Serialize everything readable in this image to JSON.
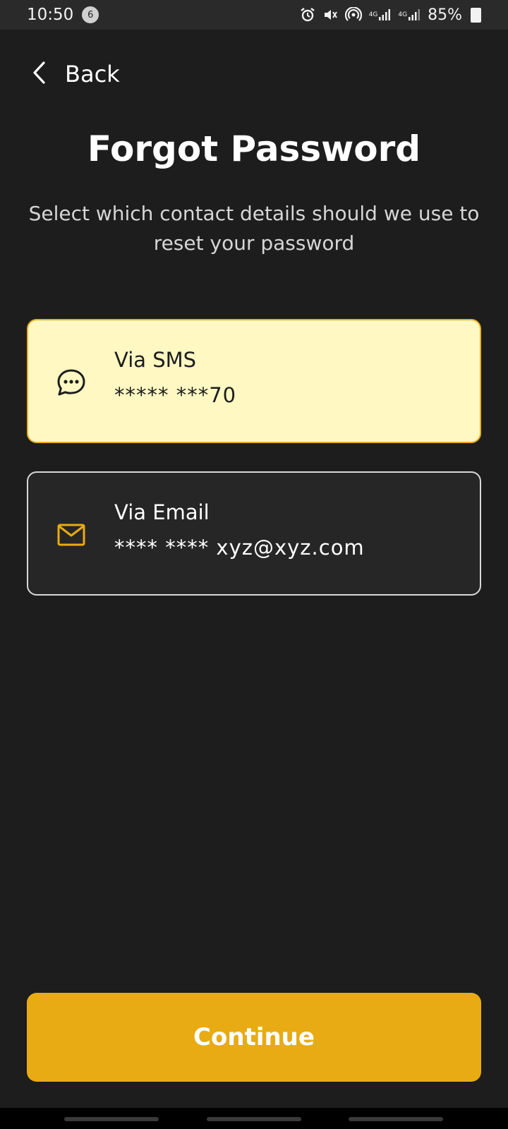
{
  "status_bar": {
    "time": "10:50",
    "notification_count": "6",
    "network_1": "4G",
    "network_2": "4G",
    "battery_percent": "85%"
  },
  "header": {
    "back_label": "Back",
    "title": "Forgot Password",
    "subtitle": "Select which contact details should we use to reset your password"
  },
  "options": [
    {
      "label": "Via SMS",
      "value": "***** ***70",
      "icon": "chat-bubble-icon",
      "selected": true
    },
    {
      "label": "Via Email",
      "value": "**** **** xyz@xyz.com",
      "icon": "mail-icon",
      "selected": false
    }
  ],
  "actions": {
    "continue_label": "Continue"
  },
  "colors": {
    "background": "#1d1d1d",
    "accent": "#e9ab13",
    "selected_card": "#fff8c2",
    "selected_border": "#e8b020",
    "card": "#262626"
  }
}
